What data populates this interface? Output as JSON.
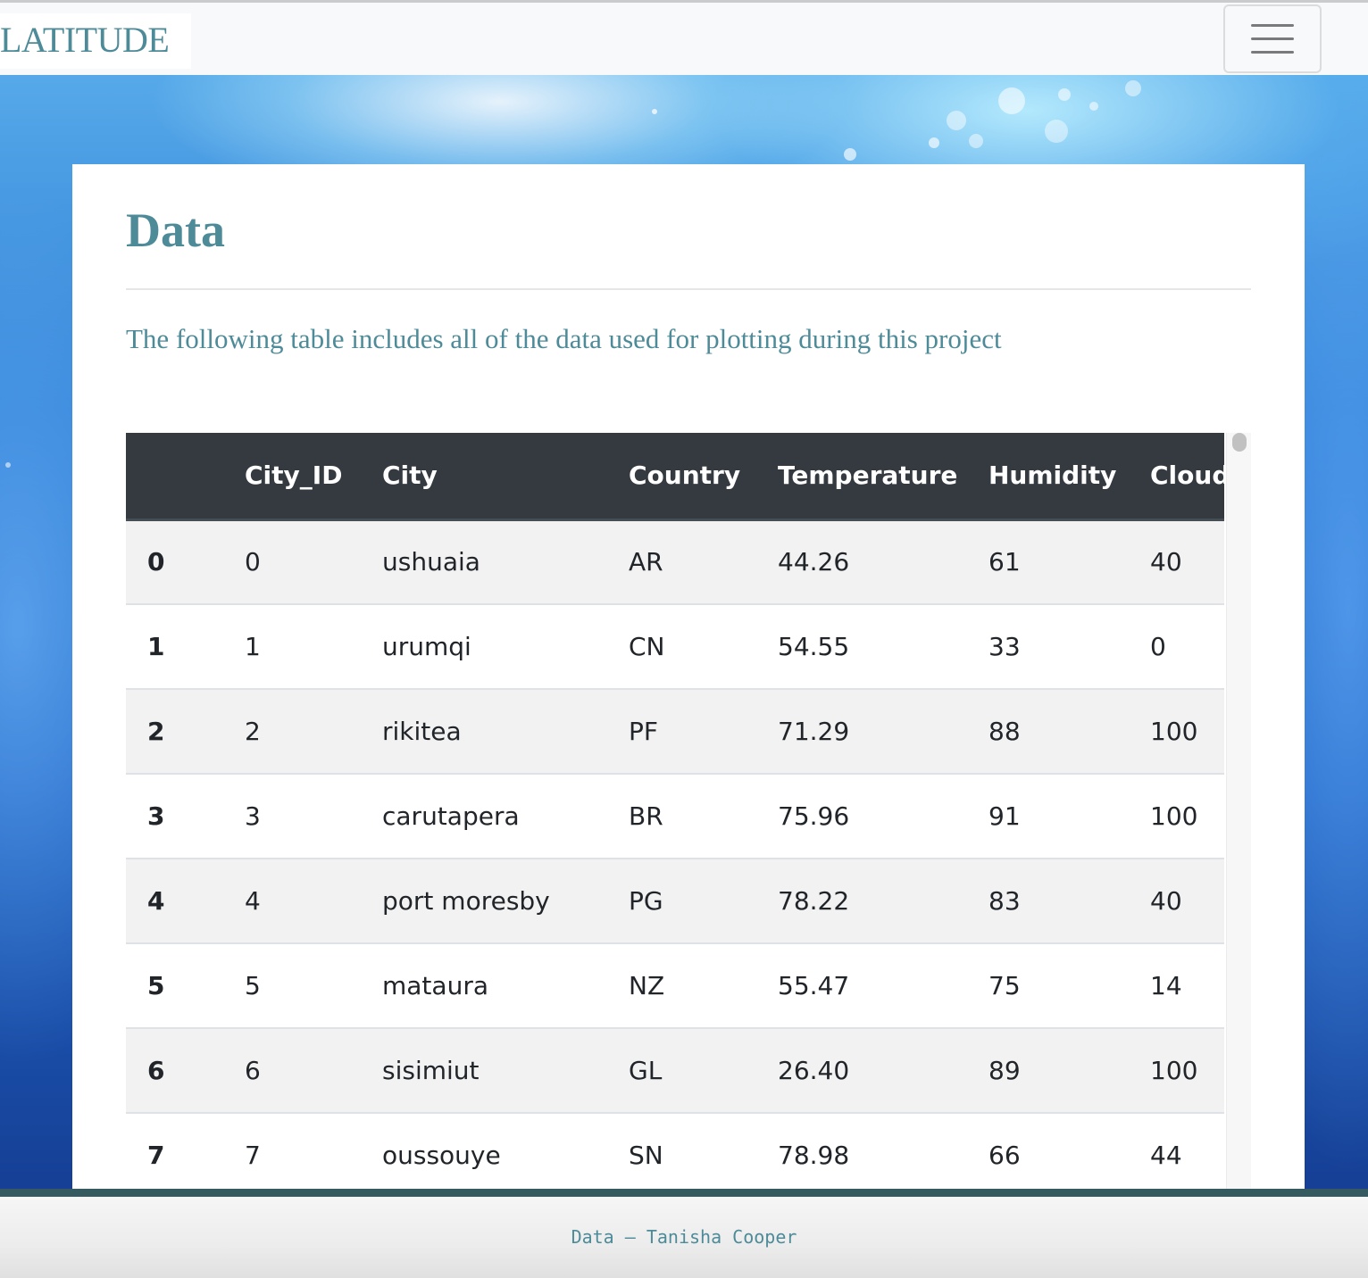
{
  "navbar": {
    "brand": "LATITUDE",
    "menu_icon": "hamburger-menu-icon"
  },
  "page": {
    "title": "Data",
    "description": "The following table includes all of the data used for plotting during this project"
  },
  "table": {
    "columns": [
      "",
      "City_ID",
      "City",
      "Country",
      "Temperature",
      "Humidity",
      "Cloudiness"
    ],
    "rows": [
      [
        "0",
        "0",
        "ushuaia",
        "AR",
        "44.26",
        "61",
        "40"
      ],
      [
        "1",
        "1",
        "urumqi",
        "CN",
        "54.55",
        "33",
        "0"
      ],
      [
        "2",
        "2",
        "rikitea",
        "PF",
        "71.29",
        "88",
        "100"
      ],
      [
        "3",
        "3",
        "carutapera",
        "BR",
        "75.96",
        "91",
        "100"
      ],
      [
        "4",
        "4",
        "port moresby",
        "PG",
        "78.22",
        "83",
        "40"
      ],
      [
        "5",
        "5",
        "mataura",
        "NZ",
        "55.47",
        "75",
        "14"
      ],
      [
        "6",
        "6",
        "sisimiut",
        "GL",
        "26.40",
        "89",
        "100"
      ],
      [
        "7",
        "7",
        "oussouye",
        "SN",
        "78.98",
        "66",
        "44"
      ]
    ]
  },
  "footer": {
    "text": "Data – Tanisha Cooper"
  },
  "colors": {
    "accent": "#4e8b98",
    "table_header": "#343a40",
    "stripe": "#f2f2f2",
    "footer_bar": "#355a60"
  }
}
